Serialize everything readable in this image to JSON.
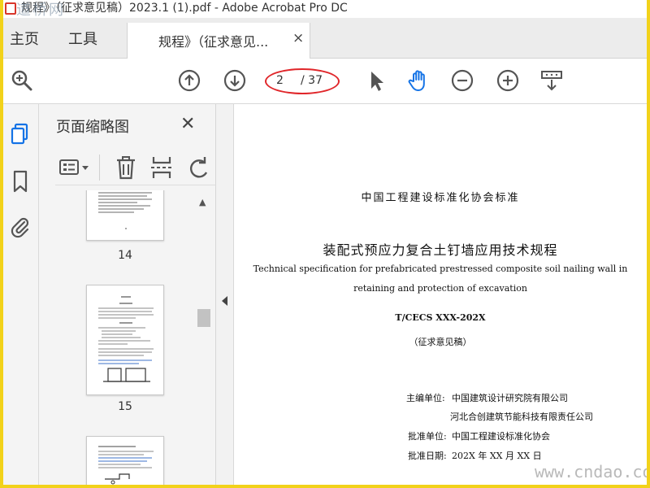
{
  "window": {
    "title": "规程》（征求意见稿）2023.1 (1).pdf - Adobe Acrobat Pro DC",
    "watermark_top": "道桥网"
  },
  "tabs": {
    "home": "主页",
    "tools": "工具",
    "document": "规程》（征求意见...",
    "close": "×"
  },
  "toolbar": {
    "current_page": "2",
    "total_pages": "/ 37"
  },
  "panel": {
    "title": "页面缩略图",
    "close": "✕",
    "thumbnails": [
      {
        "number": "14"
      },
      {
        "number": "15"
      },
      {
        "number": ""
      }
    ]
  },
  "document": {
    "org_header": "中国工程建设标准化协会标准",
    "title_cn": "装配式预应力复合土钉墙应用技术规程",
    "title_en_1": "Technical specification for prefabricated prestressed composite soil nailing wall in",
    "title_en_2": "retaining and protection of excavation",
    "code": "T/CECS XXX-202X",
    "draft": "（征求意见稿）",
    "editor_label": "主编单位:",
    "editor_1": "中国建筑设计研究院有限公司",
    "editor_2": "河北合创建筑节能科技有限责任公司",
    "approver_label": "批准单位:",
    "approver": "中国工程建设标准化协会",
    "date_label": "批准日期:",
    "date": "202X 年 XX 月 XX 日"
  },
  "watermark_bottom": "www.cndao.com",
  "colors": {
    "accent_blue": "#1473e6",
    "highlight_red": "#e0262a",
    "pdf_red": "#d8362b"
  }
}
